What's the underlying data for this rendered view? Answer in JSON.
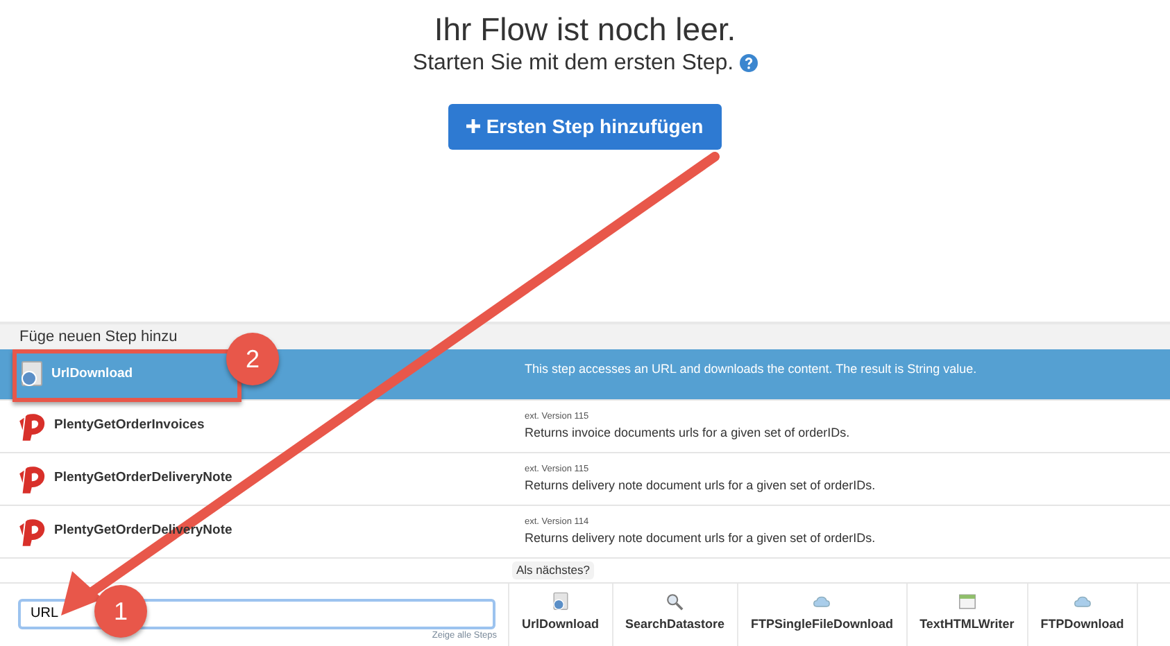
{
  "header": {
    "title": "Ihr Flow ist noch leer.",
    "subtitle": "Starten Sie mit dem ersten Step.",
    "add_button": "Ersten Step hinzufügen"
  },
  "step_panel": {
    "title": "Füge neuen Step hinzu",
    "steps": [
      {
        "name": "UrlDownload",
        "kind": "url",
        "description": "This step accesses an URL and downloads the content. The result is String value.",
        "selected": true
      },
      {
        "name": "PlentyGetOrderInvoices",
        "kind": "plenty",
        "version": "ext. Version 115",
        "description": "Returns invoice documents urls for a given set of orderIDs.",
        "selected": false
      },
      {
        "name": "PlentyGetOrderDeliveryNote",
        "kind": "plenty",
        "version": "ext. Version 115",
        "description": "Returns delivery note document urls for a given set of orderIDs.",
        "selected": false
      },
      {
        "name": "PlentyGetOrderDeliveryNote",
        "kind": "plenty",
        "version": "ext. Version 114",
        "description": "Returns delivery note document urls for a given set of orderIDs.",
        "selected": false
      }
    ]
  },
  "search": {
    "value": "URL",
    "show_all_link": "Zeige alle Steps"
  },
  "suggestions": {
    "label": "Als nächstes?",
    "items": [
      {
        "name": "UrlDownload",
        "kind": "url"
      },
      {
        "name": "SearchDatastore",
        "kind": "search"
      },
      {
        "name": "FTPSingleFileDownload",
        "kind": "cloud"
      },
      {
        "name": "TextHTMLWriter",
        "kind": "writer"
      },
      {
        "name": "FTPDownload",
        "kind": "cloud"
      }
    ]
  },
  "annotations": [
    {
      "kind": "badge",
      "text": "2"
    },
    {
      "kind": "badge",
      "text": "1"
    }
  ]
}
